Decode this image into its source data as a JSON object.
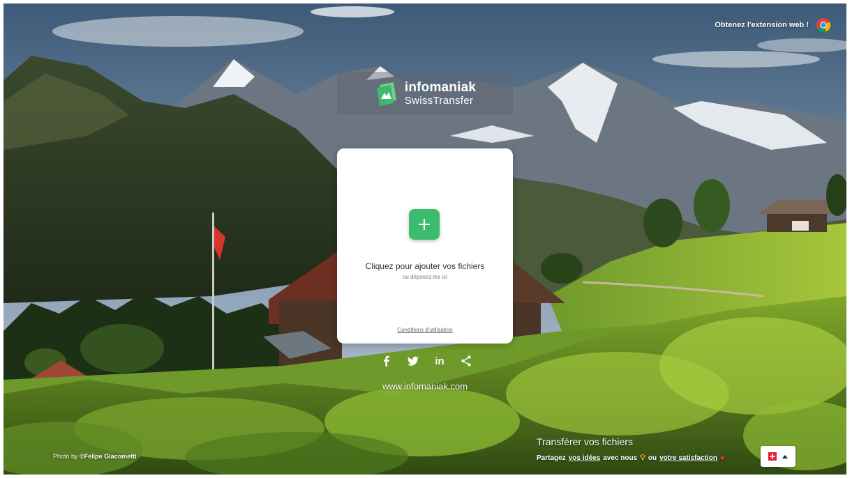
{
  "header": {
    "extension_label": "Obtenez l'extension web !",
    "extension_icon": "chrome-icon"
  },
  "logo": {
    "brand": "infomaniak",
    "product": "SwissTransfer"
  },
  "upload_card": {
    "add_icon": "plus-icon",
    "title": "Cliquez pour ajouter vos fichiers",
    "subtitle": "ou déposez-les ici",
    "terms_link": "Conditions d'utilisation"
  },
  "social": {
    "icons": [
      "facebook-icon",
      "twitter-icon",
      "linkedin-icon",
      "share-icon"
    ],
    "linkedin_text": "in"
  },
  "footer": {
    "website": "www.infomaniak.com",
    "photo_prefix": "Photo by ",
    "photo_author": "©Felipe Giacometti",
    "transfer_title": "Transférer vos fichiers",
    "share_prefix": "Partagez",
    "ideas_link": "vos idées",
    "share_middle": "avec nous",
    "or_text": "ou",
    "satisfaction_link": "votre satisfaction",
    "language_flag": "swiss-flag-icon"
  },
  "colors": {
    "accent_green": "#3cba6e",
    "flag_red": "#e5202e"
  }
}
